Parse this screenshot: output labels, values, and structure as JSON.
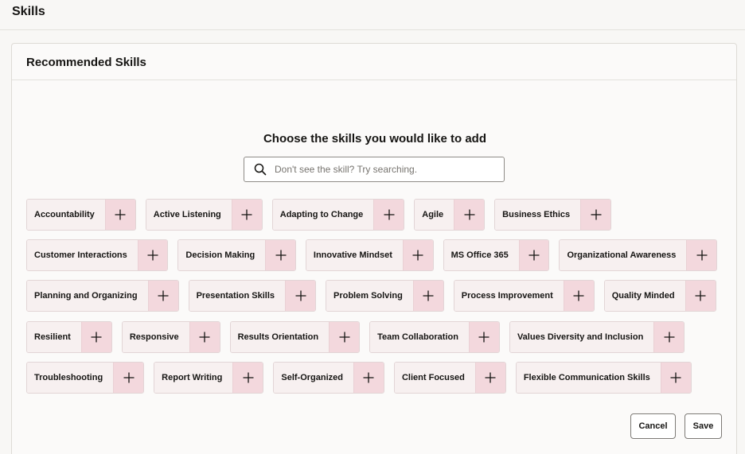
{
  "page": {
    "title": "Skills"
  },
  "card": {
    "title": "Recommended Skills"
  },
  "prompt": "Choose the skills you would like to add",
  "search": {
    "placeholder": "Don't see the skill? Try searching.",
    "value": ""
  },
  "skill_rows": [
    [
      "Accountability",
      "Active Listening",
      "Adapting to Change",
      "Agile",
      "Business Ethics"
    ],
    [
      "Customer Interactions",
      "Decision Making",
      "Innovative Mindset",
      "MS Office 365",
      "Organizational Awareness"
    ],
    [
      "Planning and Organizing",
      "Presentation Skills",
      "Problem Solving",
      "Process Improvement",
      "Quality Minded"
    ],
    [
      "Resilient",
      "Responsive",
      "Results Orientation",
      "Team Collaboration",
      "Values Diversity and Inclusion"
    ],
    [
      "Troubleshooting",
      "Report Writing",
      "Self-Organized",
      "Client Focused",
      "Flexible Communication Skills"
    ]
  ],
  "buttons": {
    "cancel": "Cancel",
    "save": "Save"
  },
  "icons": {
    "search": "search-icon",
    "add": "plus-icon"
  },
  "colors": {
    "chip_bg": "#f7f0f0",
    "chip_add_bg": "#f3d8dd",
    "border": "#dedbd6"
  }
}
